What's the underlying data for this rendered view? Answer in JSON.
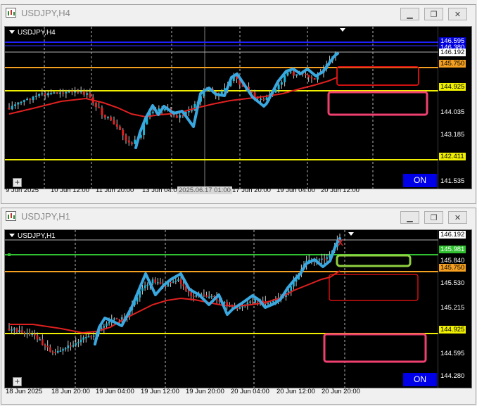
{
  "windows": [
    {
      "id": "h4",
      "title": "USDJPY,H4",
      "symbol_label": "USDJPY,H4",
      "on_label": "ON",
      "prices": [
        {
          "text": "146.595",
          "color": "#0000e0",
          "fg": "#fff"
        },
        {
          "text": "146.380",
          "color": "#0000e0",
          "fg": "#fff"
        },
        {
          "text": "146.192",
          "color": "#ffffff",
          "fg": "#000"
        },
        {
          "text": "145.750",
          "color": "#f5a020",
          "fg": "#000"
        },
        {
          "text": "144.925",
          "color": "#f0f000",
          "fg": "#000"
        },
        {
          "text": "144.035",
          "color": "",
          "fg": "#fff"
        },
        {
          "text": "143.185",
          "color": "",
          "fg": "#fff"
        },
        {
          "text": "142.411",
          "color": "#f0f000",
          "fg": "#000"
        },
        {
          "text": "141.535",
          "color": "",
          "fg": "#fff"
        }
      ],
      "times": [
        "9 Jun 2025",
        "10 Jun 12:00",
        "11 Jun 20:00",
        "13 Jun 04:00",
        "2025.06.17 01:00",
        "17 Jun 20:00",
        "19 Jun 04:00",
        "20 Jun 12:00"
      ]
    },
    {
      "id": "h1",
      "title": "USDJPY,H1",
      "symbol_label": "USDJPY,H1",
      "on_label": "ON",
      "prices": [
        {
          "text": "146.192",
          "color": "#ffffff",
          "fg": "#000"
        },
        {
          "text": "145.981",
          "color": "#30c030",
          "fg": "#fff"
        },
        {
          "text": "145.840",
          "color": "",
          "fg": "#fff"
        },
        {
          "text": "145.750",
          "color": "#f5a020",
          "fg": "#000"
        },
        {
          "text": "145.530",
          "color": "",
          "fg": "#fff"
        },
        {
          "text": "145.215",
          "color": "",
          "fg": "#fff"
        },
        {
          "text": "144.925",
          "color": "#f0f000",
          "fg": "#000"
        },
        {
          "text": "144.595",
          "color": "",
          "fg": "#fff"
        },
        {
          "text": "144.280",
          "color": "",
          "fg": "#fff"
        }
      ],
      "times": [
        "18 Jun 2025",
        "18 Jun 20:00",
        "19 Jun 04:00",
        "19 Jun 12:00",
        "19 Jun 20:00",
        "20 Jun 04:00",
        "20 Jun 12:00",
        "20 Jun 20:00"
      ]
    }
  ],
  "icons": {
    "app": "chart-window-icon",
    "minimize": "minimize-icon",
    "restore": "restore-icon",
    "close": "close-icon",
    "plus": "plus-icon"
  },
  "colors": {
    "bull": "#1fb6d6",
    "bear": "#e02020",
    "ma": "#e02020",
    "trendline": "#3aa8e0",
    "zone_red": "#d01010",
    "zone_pink": "#f04070",
    "zone_green": "#90d040"
  }
}
